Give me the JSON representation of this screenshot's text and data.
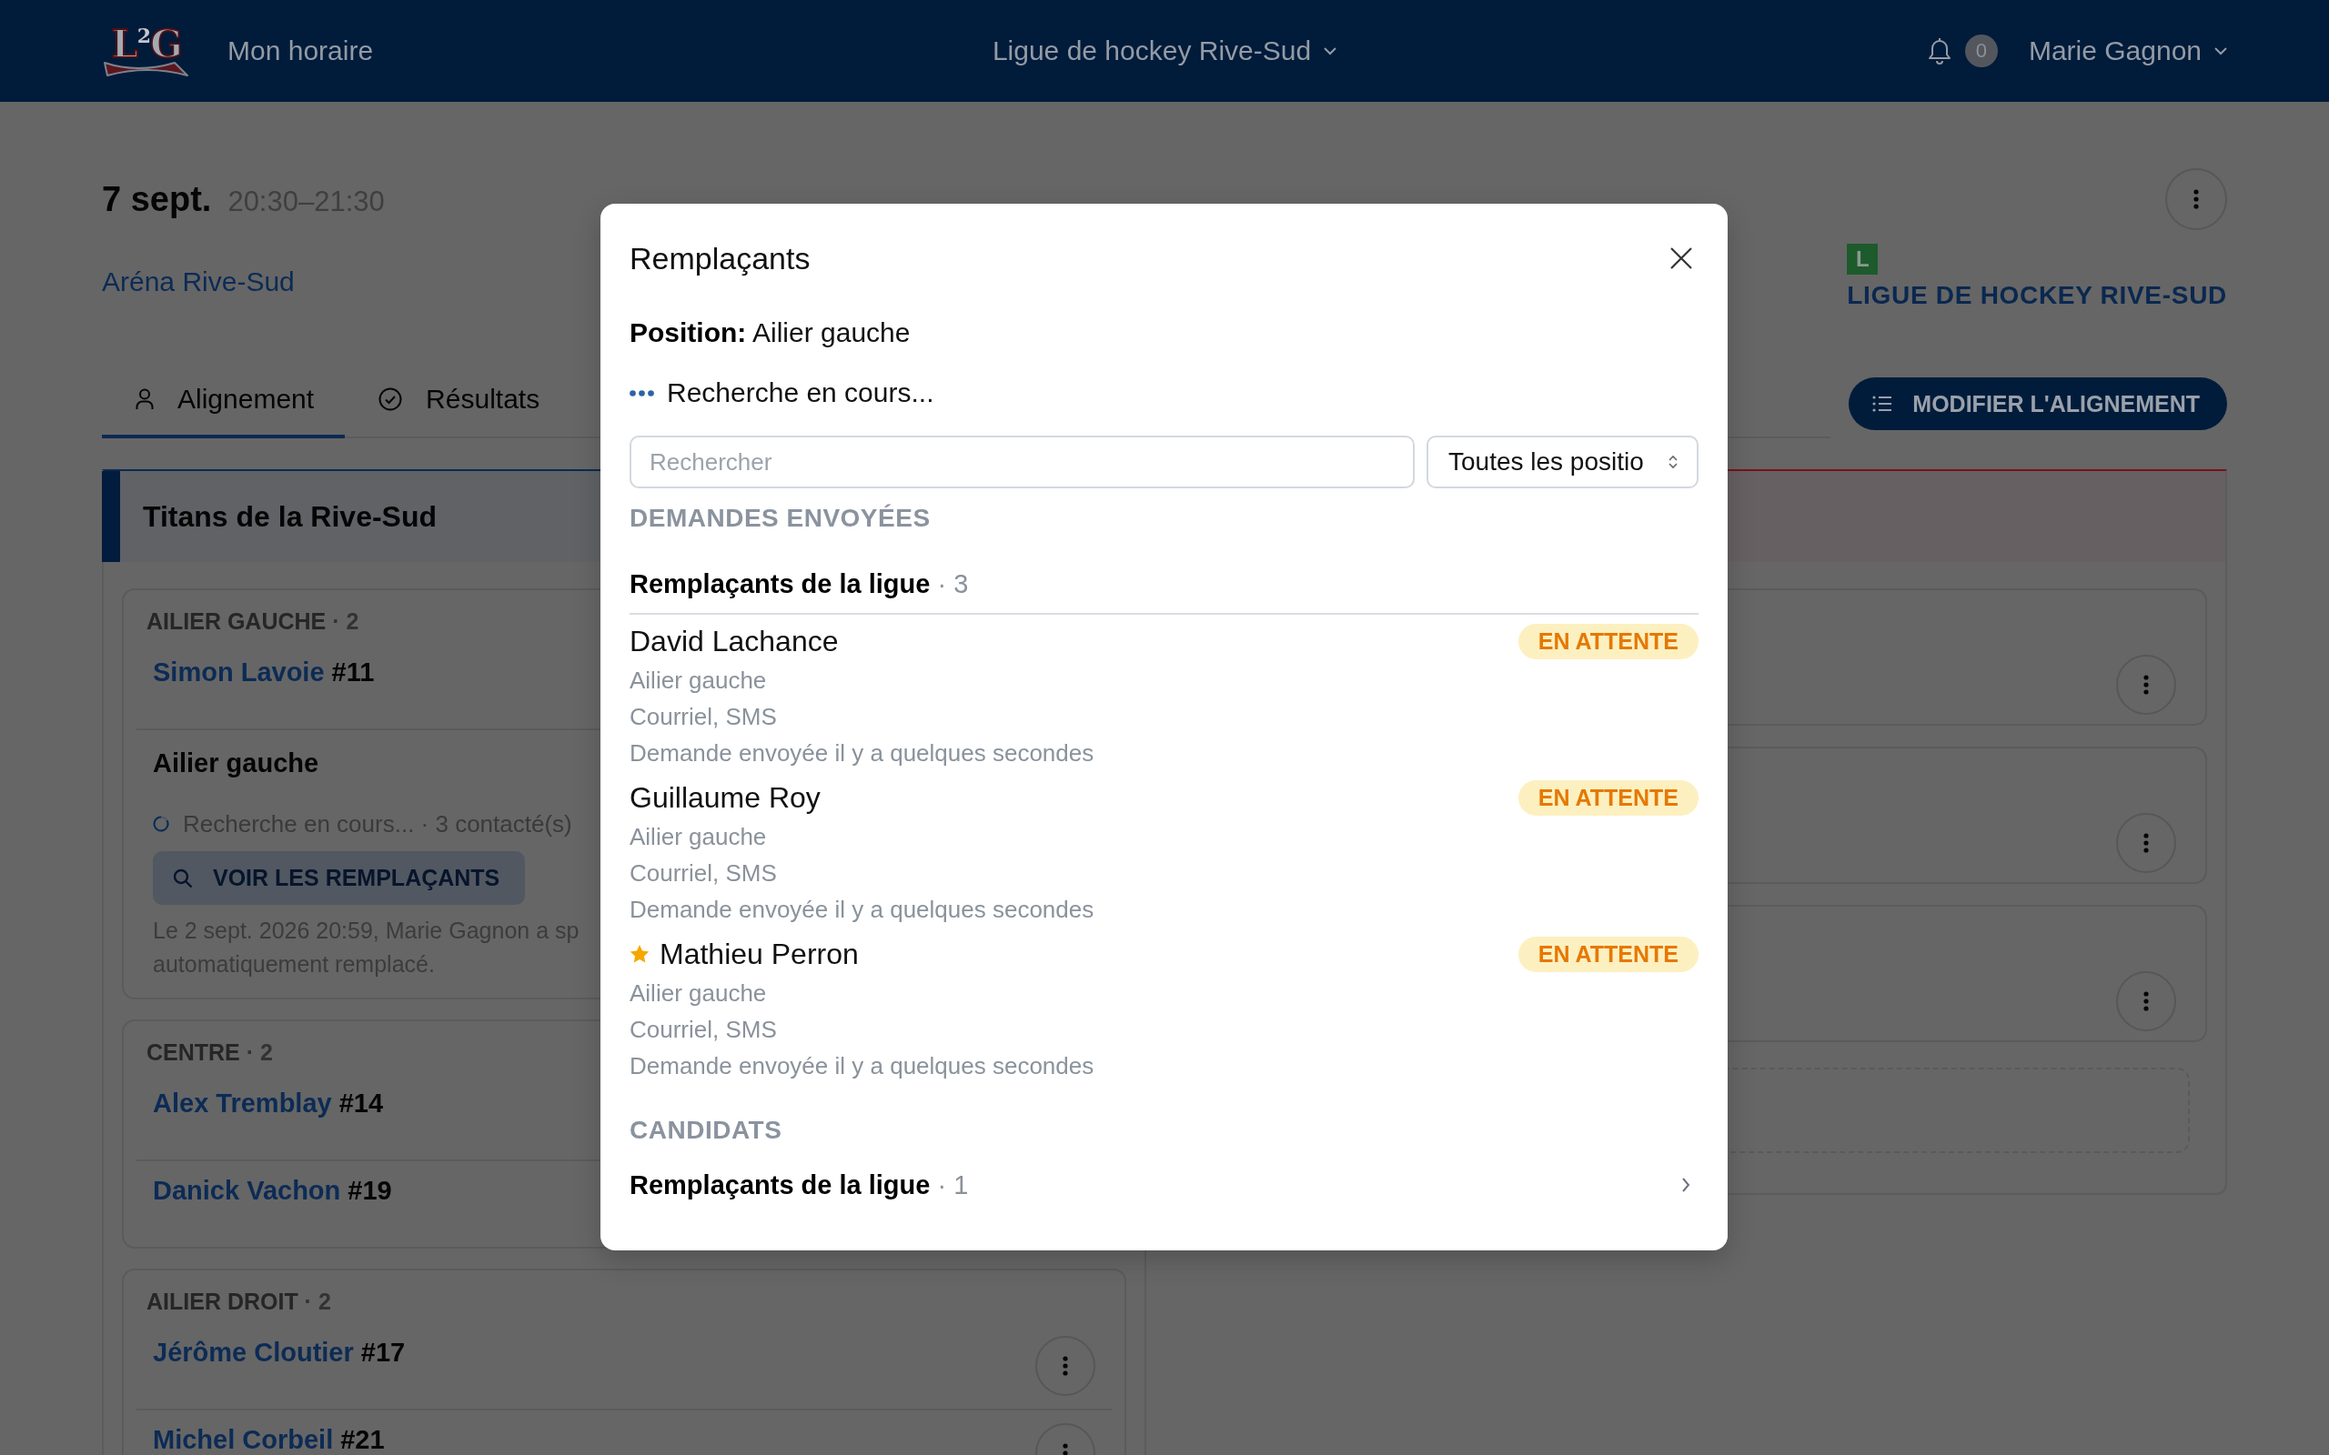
{
  "header": {
    "logo": "L$^{2}$G",
    "nav_link": "Mon horaire",
    "league_menu": "Ligue de hockey Rive-Sud",
    "notification_count": "0",
    "user_menu": "Marie Gagnon"
  },
  "event": {
    "date": "7 sept.",
    "time": "20:30–21:30",
    "venue": "Aréna Rive-Sud",
    "league_badge": "L",
    "league_name": "LIGUE DE HOCKEY RIVE-SUD"
  },
  "tabs": [
    {
      "kind": "lineup",
      "label": "Alignement",
      "selected": true
    },
    {
      "kind": "results",
      "label": "Résultats",
      "selected": false
    }
  ],
  "edit_lineup_button": "MODIFIER L'ALIGNEMENT",
  "teams": [
    {
      "kind": "home",
      "name": "Titans de la Rive-Sud",
      "groups": [
        {
          "label": "AILIER GAUCHE",
          "count": "· 2",
          "slots": [
            {
              "kind": "player",
              "name": "Simon Lavoie",
              "number": "#11",
              "menu": false
            },
            {
              "kind": "vacancy",
              "position": "Ailier gauche",
              "status": "Recherche en cours... · 3 contacté(s)",
              "button": "VOIR LES REMPLAÇANTS",
              "note": "Le 2 sept. 2026 20:59, Marie Gagnon a sp\nautomatiquement remplacé."
            }
          ]
        },
        {
          "label": "CENTRE",
          "count": "· 2",
          "slots": [
            {
              "kind": "player",
              "name": "Alex Tremblay",
              "number": "#14",
              "menu": false
            },
            {
              "kind": "player",
              "name": "Danick Vachon",
              "number": "#19",
              "menu": false
            }
          ]
        },
        {
          "label": "AILIER DROIT",
          "count": "· 2",
          "slots": [
            {
              "kind": "player",
              "name": "Jérôme Cloutier",
              "number": "#17",
              "menu": true
            },
            {
              "kind": "player",
              "name": "Michel Corbeil",
              "number": "#21",
              "menu": true
            }
          ]
        }
      ]
    },
    {
      "kind": "away",
      "cards": [
        {
          "kind": "player",
          "menu": true
        },
        {
          "kind": "player",
          "menu": true
        },
        {
          "kind": "player",
          "menu": true
        },
        {
          "kind": "open"
        }
      ]
    }
  ],
  "modal": {
    "title": "Remplaçants",
    "position": "**Position:** Ailier gauche",
    "status": "Recherche en cours...",
    "search_placeholder": "Rechercher",
    "position_filter": "Toutes les positio",
    "sections": [
      {
        "title": "DEMANDES ENVOYÉES",
        "groups": [
          {
            "title": "Remplaçants de la ligue",
            "count": "· 3",
            "expanded": true,
            "requests": [
              {
                "name": "David Lachance",
                "favorite": false,
                "position": "Ailier gauche",
                "channels": "Courriel, SMS",
                "sent": "Demande envoyée il y a quelques secondes",
                "status": "EN ATTENTE"
              },
              {
                "name": "Guillaume Roy",
                "favorite": false,
                "position": "Ailier gauche",
                "channels": "Courriel, SMS",
                "sent": "Demande envoyée il y a quelques secondes",
                "status": "EN ATTENTE"
              },
              {
                "name": "Mathieu Perron",
                "favorite": true,
                "position": "Ailier gauche",
                "channels": "Courriel, SMS",
                "sent": "Demande envoyée il y a quelques secondes",
                "status": "EN ATTENTE"
              }
            ]
          }
        ]
      },
      {
        "title": "CANDIDATS",
        "groups": [
          {
            "title": "Remplaçants de la ligue",
            "count": "· 1",
            "expanded": false
          }
        ]
      }
    ]
  }
}
